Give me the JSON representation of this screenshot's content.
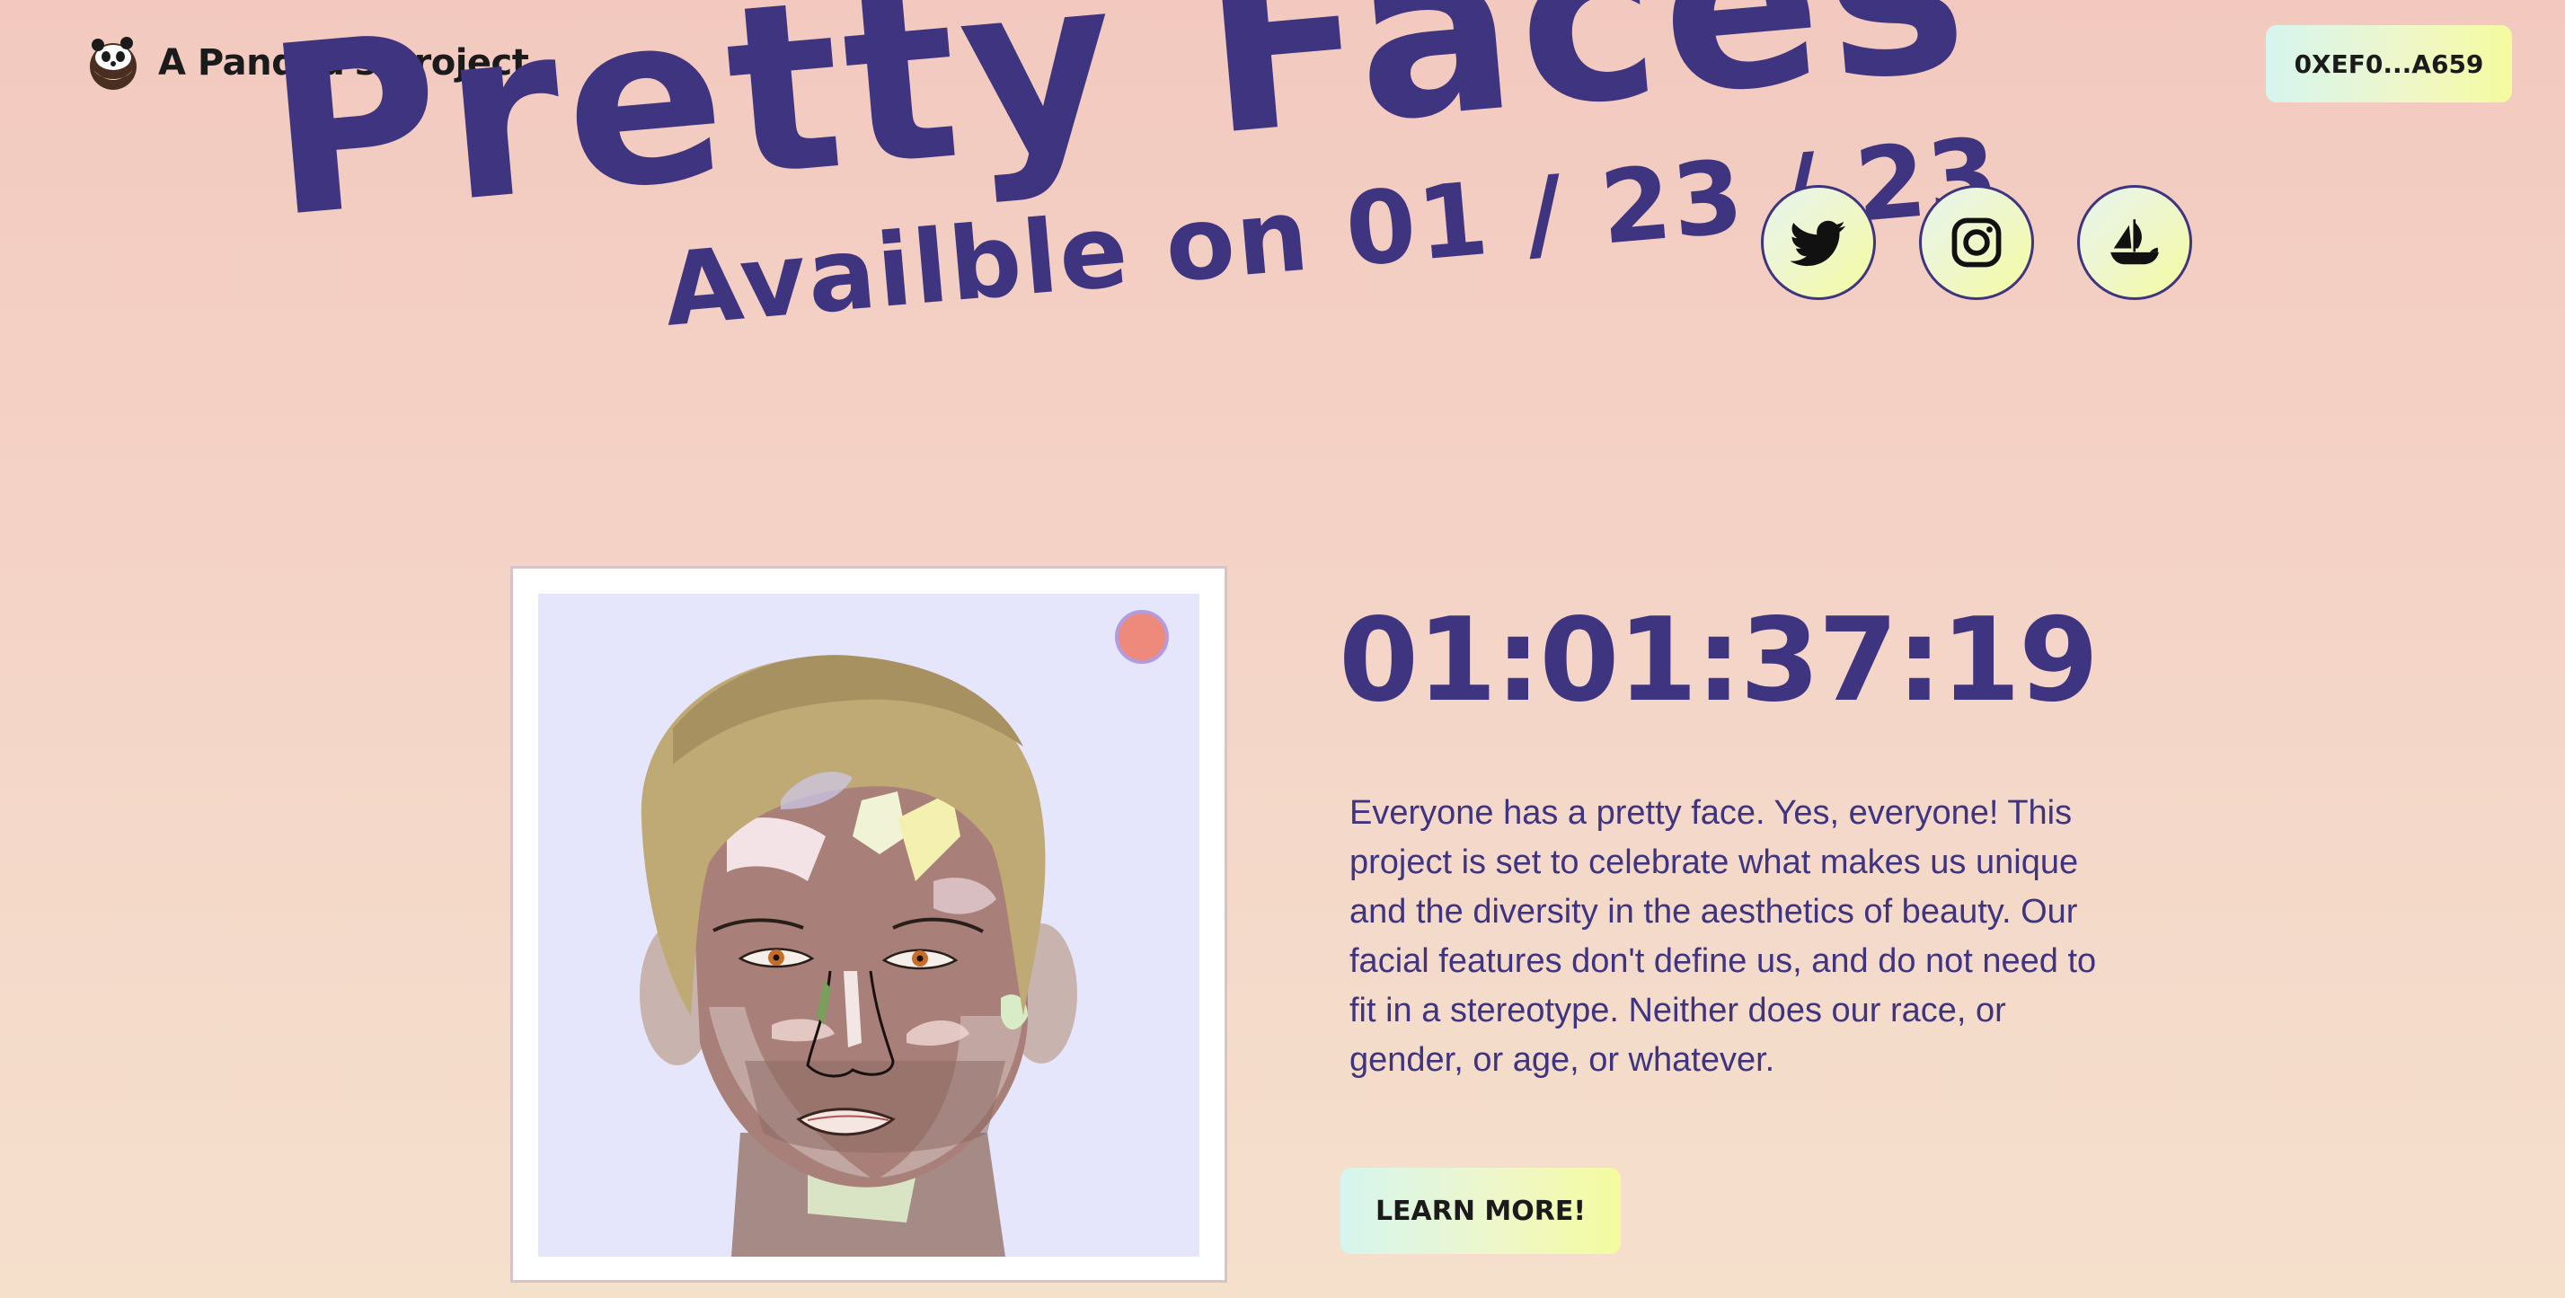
{
  "header": {
    "brand_name": "A Pandaa's Project",
    "wallet_label": "0XEF0...A659"
  },
  "hero": {
    "title": "Pretty Faces",
    "subtitle": "Availble on 01 / 23 / 23"
  },
  "social": [
    {
      "name": "twitter-icon"
    },
    {
      "name": "instagram-icon"
    },
    {
      "name": "opensea-icon"
    }
  ],
  "countdown": "01:01:37:19",
  "description": "Everyone has a pretty face. Yes, everyone! This project is set to celebrate what makes us unique and the diversity in the aesthetics of beauty. Our facial features don't define us, and do not need to fit in a stereotype. Neither does our race, or gender, or age, or whatever.",
  "cta": {
    "learn_more_label": "LEARN MORE!"
  },
  "colors": {
    "brand_purple": "#3f3480",
    "button_gradient_start": "#d6f5ef",
    "button_gradient_end": "#f4fb9e",
    "background_top": "#f3c9bf",
    "background_bottom": "#f5e0cc"
  }
}
